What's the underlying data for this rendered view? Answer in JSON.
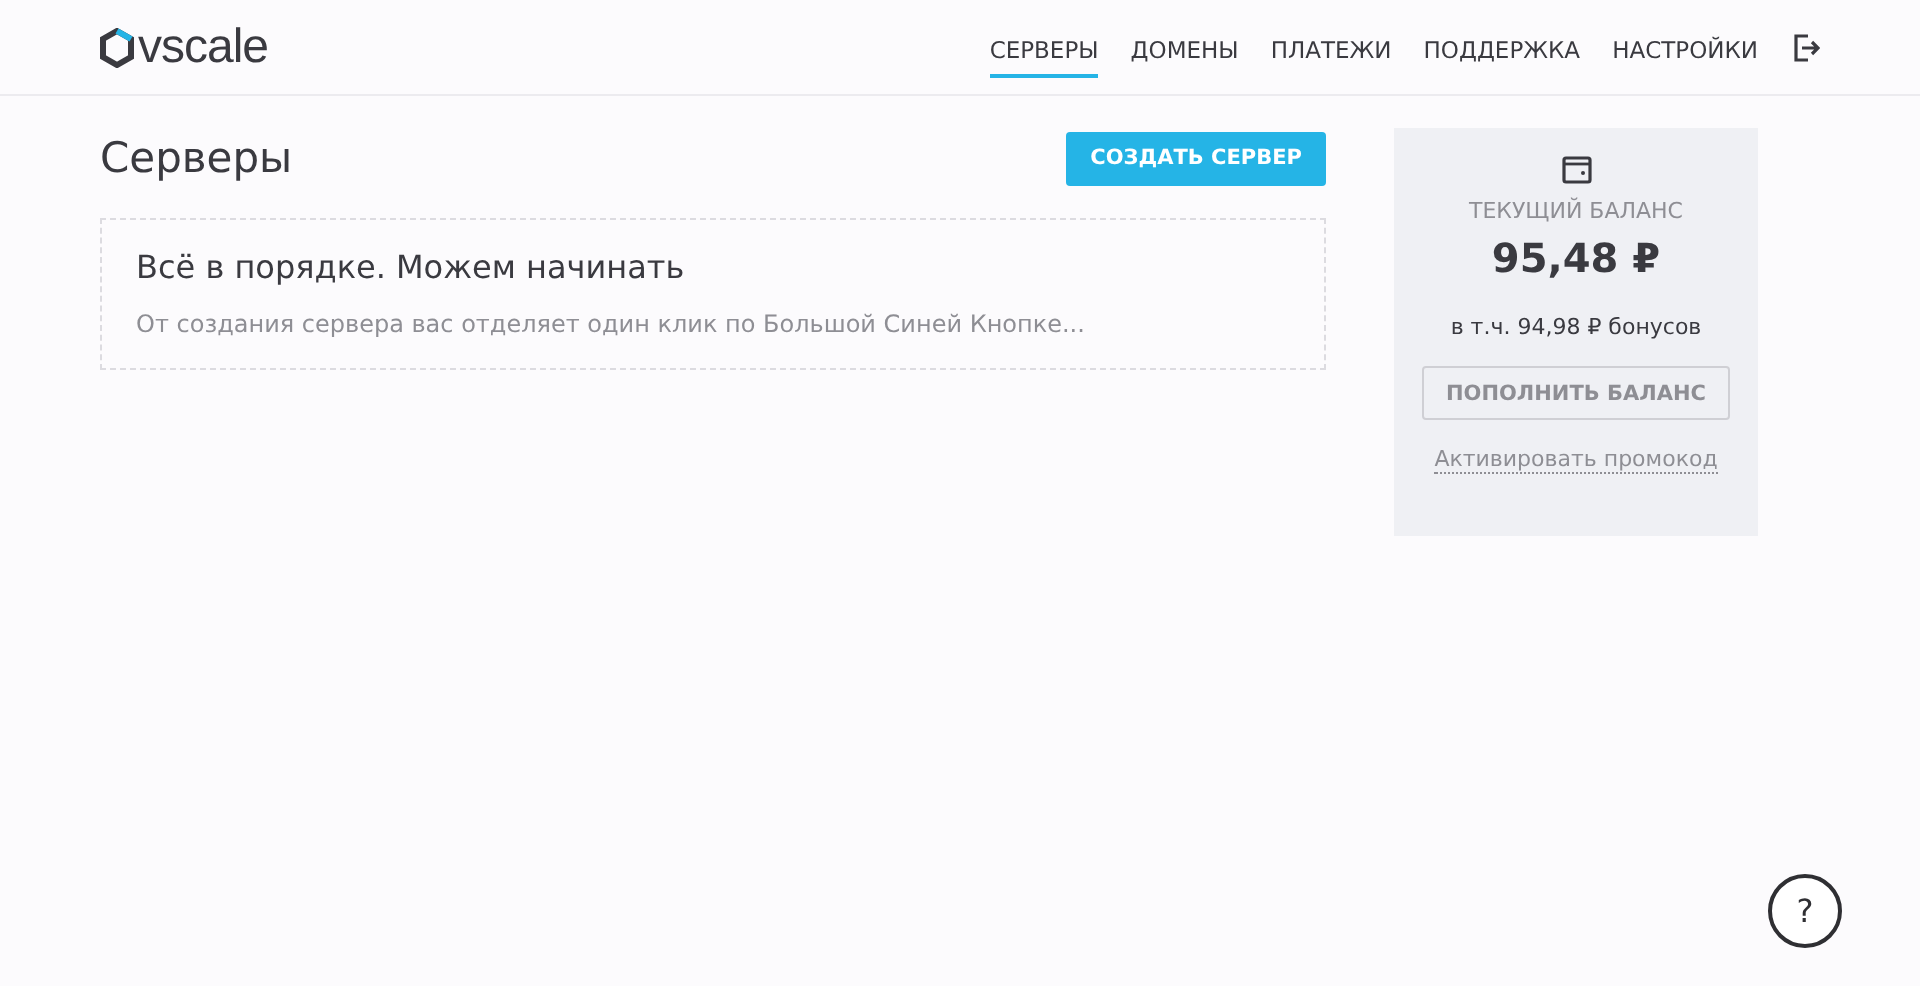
{
  "header": {
    "logo": "vscale",
    "nav": [
      {
        "label": "СЕРВЕРЫ",
        "selected": true
      },
      {
        "label": "ДОМЕНЫ",
        "selected": false
      },
      {
        "label": "ПЛАТЕЖИ",
        "selected": false
      },
      {
        "label": "ПОДДЕРЖКА",
        "selected": false
      },
      {
        "label": "НАСТРОЙКИ",
        "selected": false
      }
    ]
  },
  "page": {
    "title": "Серверы",
    "create_button": "СОЗДАТЬ СЕРВЕР",
    "empty_state": {
      "heading": "Всё в порядке. Можем начинать",
      "text": "От создания сервера вас отделяет один клик по Большой Синей Кнопке..."
    }
  },
  "balance": {
    "label": "ТЕКУЩИЙ БАЛАНС",
    "amount": "95,48 ₽",
    "bonus": "в т.ч. 94,98 ₽ бонусов",
    "topup_button": "ПОПОЛНИТЬ БАЛАНС",
    "promo_link": "Активировать промокод"
  },
  "help_button": "?"
}
